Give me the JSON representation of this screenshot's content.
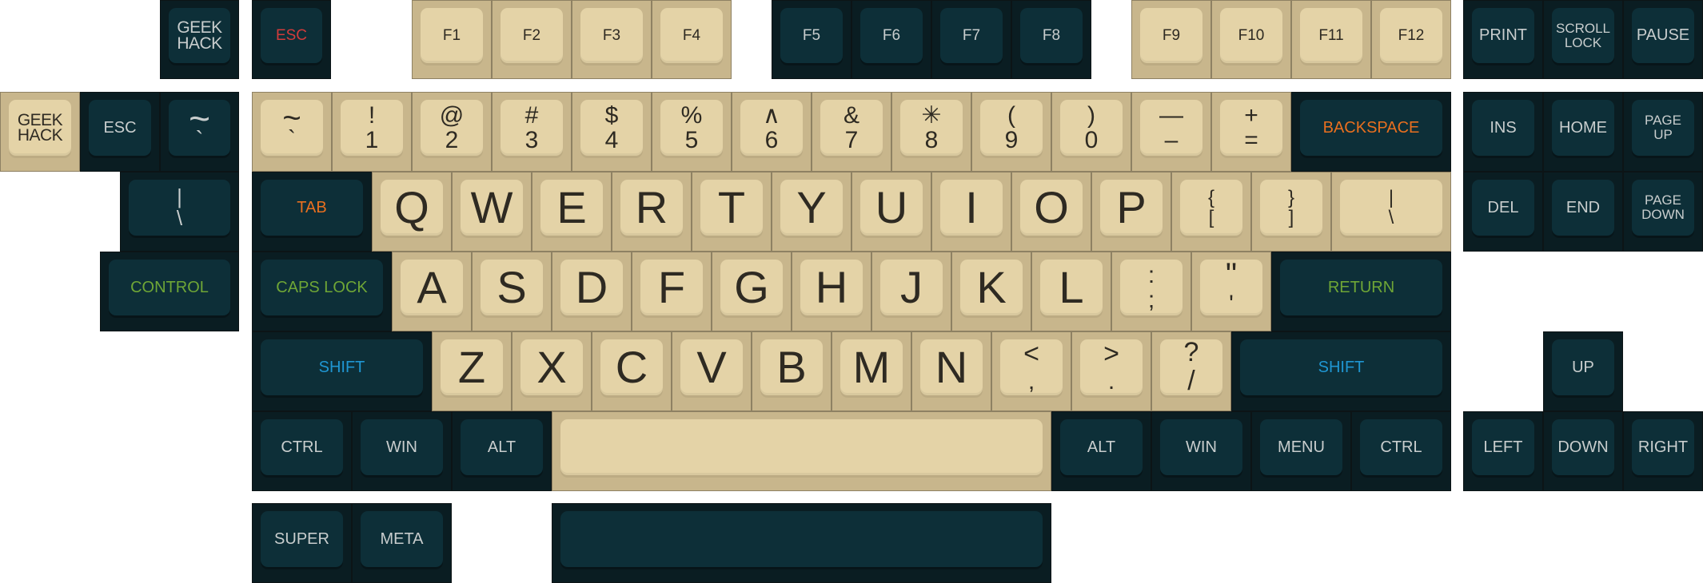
{
  "colors": {
    "beige": "#e4d3a7",
    "beige_base": "#c8b68c",
    "dark": "#0d2f38",
    "dark_base": "#0a1d22",
    "accent_red": "#d23b3b",
    "accent_orange": "#e86f1f",
    "accent_green": "#6fa636",
    "accent_blue": "#1f96d2"
  },
  "top_row": {
    "logo": [
      "GEEK",
      "HACK"
    ],
    "esc": "ESC",
    "f1": "F1",
    "f2": "F2",
    "f3": "F3",
    "f4": "F4",
    "f5": "F5",
    "f6": "F6",
    "f7": "F7",
    "f8": "F8",
    "f9": "F9",
    "f10": "F10",
    "f11": "F11",
    "f12": "F12",
    "print": "PRINT",
    "scroll": [
      "SCROLL",
      "LOCK"
    ],
    "pause": "PAUSE"
  },
  "extras": {
    "logo": [
      "GEEK",
      "HACK"
    ],
    "esc": "ESC",
    "tilde": [
      "~",
      "`"
    ],
    "pipe": [
      "|",
      "\\"
    ],
    "control": "CONTROL"
  },
  "number_row": {
    "k1": [
      "~",
      "`"
    ],
    "k2": [
      "!",
      "1"
    ],
    "k3": [
      "@",
      "2"
    ],
    "k4": [
      "#",
      "3"
    ],
    "k5": [
      "$",
      "4"
    ],
    "k6": [
      "%",
      "5"
    ],
    "k7": [
      "∧",
      "6"
    ],
    "k8": [
      "&",
      "7"
    ],
    "k9": [
      "✳",
      "8"
    ],
    "k10": [
      "(",
      "9"
    ],
    "k11": [
      ")",
      "0"
    ],
    "k12": [
      "—",
      "–"
    ],
    "k13": [
      "+",
      "="
    ],
    "backspace": "BACKSPACE"
  },
  "q_row": {
    "tab": "TAB",
    "letters": [
      "Q",
      "W",
      "E",
      "R",
      "T",
      "Y",
      "U",
      "I",
      "O",
      "P"
    ],
    "lbrace": [
      "{",
      "["
    ],
    "rbrace": [
      "}",
      "]"
    ],
    "pipe": [
      "|",
      "\\"
    ]
  },
  "a_row": {
    "caps": "CAPS LOCK",
    "letters": [
      "A",
      "S",
      "D",
      "F",
      "G",
      "H",
      "J",
      "K",
      "L"
    ],
    "semicolon": [
      ":",
      ";"
    ],
    "quote": [
      "\"",
      "'"
    ],
    "return": "RETURN"
  },
  "z_row": {
    "lshift": "SHIFT",
    "letters": [
      "Z",
      "X",
      "C",
      "V",
      "B",
      "M",
      "N"
    ],
    "comma": [
      "<",
      ","
    ],
    "period": [
      ">",
      "."
    ],
    "slash": [
      "?",
      "/"
    ],
    "rshift": "SHIFT"
  },
  "bottom_row": {
    "lctrl": "CTRL",
    "lwin": "WIN",
    "lalt": "ALT",
    "ralt": "ALT",
    "rwin": "WIN",
    "menu": "MENU",
    "rctrl": "CTRL"
  },
  "extras_bottom": {
    "super": "SUPER",
    "meta": "META"
  },
  "nav": {
    "ins": "INS",
    "home": "HOME",
    "pgup": [
      "PAGE",
      "UP"
    ],
    "del": "DEL",
    "end": "END",
    "pgdn": [
      "PAGE",
      "DOWN"
    ]
  },
  "arrows": {
    "up": "UP",
    "left": "LEFT",
    "down": "DOWN",
    "right": "RIGHT"
  }
}
